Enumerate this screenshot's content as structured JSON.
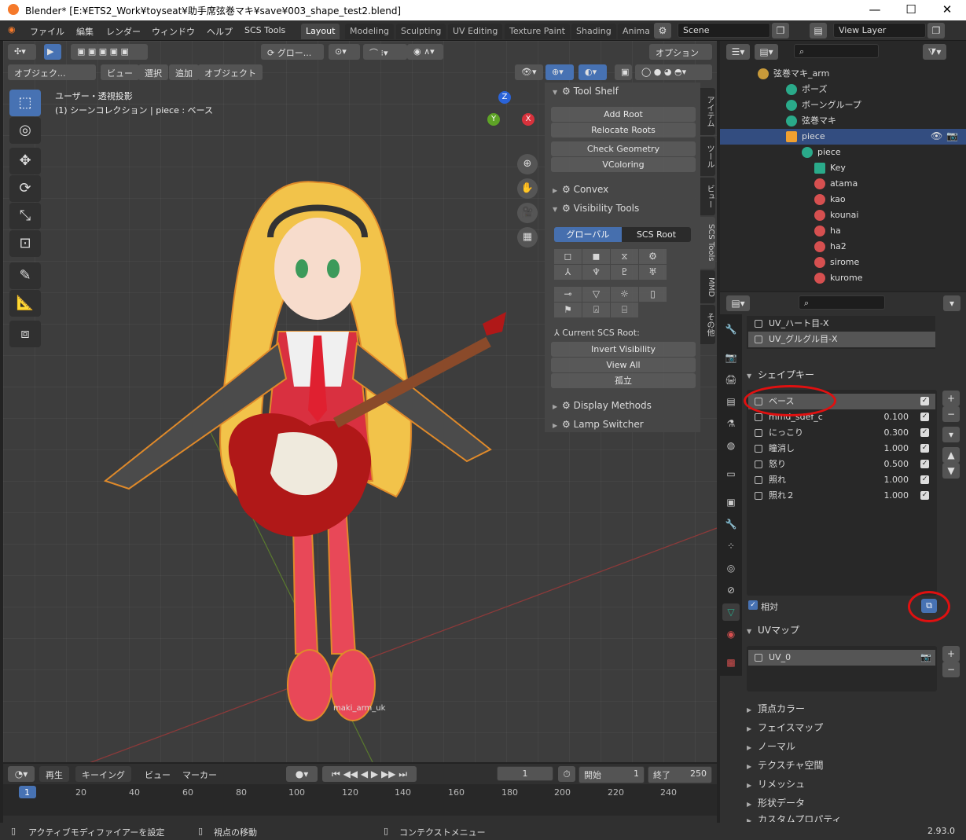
{
  "titlebar": {
    "title": "Blender* [E:¥ETS2_Work¥toyseat¥助手席弦巻マキ¥save¥003_shape_test2.blend]",
    "minimize": "—",
    "maximize": "☐",
    "close": "✕"
  },
  "menu": [
    "ファイル",
    "編集",
    "レンダー",
    "ウィンドウ",
    "ヘルプ",
    "SCS Tools"
  ],
  "workspaces": [
    "Layout",
    "Modeling",
    "Sculpting",
    "UV Editing",
    "Texture Paint",
    "Shading",
    "Anima"
  ],
  "scene": "Scene",
  "view_layer": "View Layer",
  "viewport": {
    "mode": "オブジェク...",
    "menus": [
      "ビュー",
      "選択",
      "追加",
      "オブジェクト"
    ],
    "transform": "グロー...",
    "options": "オプション",
    "overlay_line1": "ユーザー・透視投影",
    "overlay_line2": "(1) シーンコレクション | piece : ベース",
    "armature_label": "maki_arm_uk",
    "gizmo": {
      "x": "X",
      "y": "Y",
      "z": "Z"
    }
  },
  "npanel_tabs": [
    "アイテム",
    "ツール",
    "ビュー",
    "SCS Tools",
    "MMD",
    "その他"
  ],
  "npanel": {
    "tool_shelf": "Tool Shelf",
    "add_root": "Add Root",
    "relocate_roots": "Relocate Roots",
    "check_geometry": "Check Geometry",
    "vcoloring": "VColoring",
    "convex": "Convex",
    "visibility_tools": "Visibility Tools",
    "global": "グローバル",
    "scs_root": "SCS Root",
    "current_root": "Current SCS Root:",
    "invert_visibility": "Invert Visibility",
    "view_all": "View All",
    "isolate": "孤立",
    "display_methods": "Display Methods",
    "lamp_switcher": "Lamp Switcher"
  },
  "outliner": [
    {
      "label": "弦巻マキ_arm",
      "indent": 0
    },
    {
      "label": "ポーズ",
      "indent": 1
    },
    {
      "label": "ボーングループ",
      "indent": 1
    },
    {
      "label": "弦巻マキ",
      "indent": 1
    },
    {
      "label": "piece",
      "indent": 1
    },
    {
      "label": "piece",
      "indent": 2
    },
    {
      "label": "Key",
      "indent": 3
    },
    {
      "label": "atama",
      "indent": 3
    },
    {
      "label": "kao",
      "indent": 3
    },
    {
      "label": "kounai",
      "indent": 3
    },
    {
      "label": "ha",
      "indent": 3
    },
    {
      "label": "ha2",
      "indent": 3
    },
    {
      "label": "sirome",
      "indent": 3
    },
    {
      "label": "kurome",
      "indent": 3
    }
  ],
  "properties": {
    "uv_list": [
      "UV_ハート目-X",
      "UV_グルグル目-X"
    ],
    "shape_keys_title": "シェイプキー",
    "shape_keys": [
      {
        "name": "ベース",
        "value": ""
      },
      {
        "name": "mmd_sdef_c",
        "value": "0.100"
      },
      {
        "name": "にっこり",
        "value": "0.300"
      },
      {
        "name": "瞳消し",
        "value": "1.000"
      },
      {
        "name": "怒り",
        "value": "0.500"
      },
      {
        "name": "照れ",
        "value": "1.000"
      },
      {
        "name": "照れ２",
        "value": "1.000"
      }
    ],
    "relative": "相対",
    "uv_maps_title": "UVマップ",
    "uv_map": "UV_0",
    "sections": [
      "頂点カラー",
      "フェイスマップ",
      "ノーマル",
      "テクスチャ空間",
      "リメッシュ",
      "形状データ",
      "カスタムプロパティ"
    ]
  },
  "timeline": {
    "menus": [
      "再生",
      "キーイング",
      "ビュー",
      "マーカー"
    ],
    "current_frame": "1",
    "start_label": "開始",
    "start": "1",
    "end_label": "終了",
    "end": "250",
    "ticks": [
      "1",
      "20",
      "40",
      "60",
      "80",
      "100",
      "120",
      "140",
      "160",
      "180",
      "200",
      "220",
      "240"
    ]
  },
  "statusbar": {
    "left": "アクティブモディファイアーを設定",
    "mid": "視点の移動",
    "ctx": "コンテクストメニュー",
    "version": "2.93.0"
  }
}
